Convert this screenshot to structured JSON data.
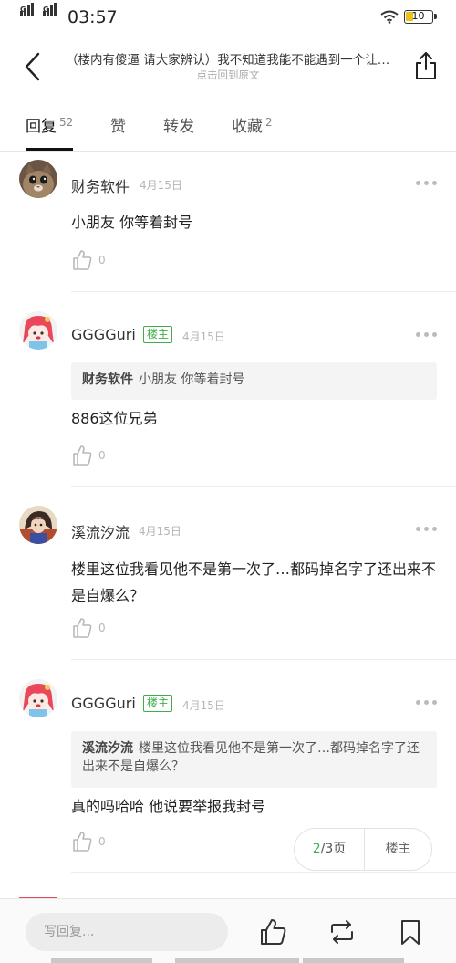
{
  "status_bar": {
    "time": "03:57",
    "sim1_label": "G",
    "sim2_label": "G",
    "battery_level": "10",
    "battery_color": "#e8c31c"
  },
  "header": {
    "thread_title": "（楼内有傻逼 请大家辨认）我不知道我能不能遇到一个让…",
    "back_to_original": "点击回到原文",
    "back_icon": "chevron-left-icon",
    "share_icon": "share-icon"
  },
  "tabs": [
    {
      "label": "回复",
      "count": "52",
      "active": true
    },
    {
      "label": "赞",
      "count": "",
      "active": false
    },
    {
      "label": "转发",
      "count": "",
      "active": false
    },
    {
      "label": "收藏",
      "count": "2",
      "active": false
    }
  ],
  "comments": [
    {
      "username": "财务软件",
      "is_op": false,
      "date": "4月15日",
      "quote": null,
      "text": "小朋友 你等着封号",
      "likes": "0",
      "avatar": "cat-avatar"
    },
    {
      "username": "GGGGuri",
      "is_op": true,
      "op_label": "楼主",
      "date": "4月15日",
      "quote": {
        "user": "财务软件",
        "text": "小朋友 你等着封号"
      },
      "text": "886这位兄弟",
      "likes": "0",
      "avatar": "cartoon-girl-avatar"
    },
    {
      "username": "溪流汐流",
      "is_op": false,
      "date": "4月15日",
      "quote": null,
      "text": "楼里这位我看见他不是第一次了…都码掉名字了还出来不是自爆么？",
      "likes": "0",
      "avatar": "anime-avatar"
    },
    {
      "username": "GGGGuri",
      "is_op": true,
      "op_label": "楼主",
      "date": "4月15日",
      "quote": {
        "user": "溪流汐流",
        "text": "楼里这位我看见他不是第一次了…都码掉名字了还出来不是自爆么？"
      },
      "text": "真的吗哈哈 他说要举报我封号",
      "likes": "0",
      "avatar": "cartoon-girl-avatar"
    }
  ],
  "pager": {
    "current": "2",
    "total_label": "/3页",
    "op_only_label": "楼主"
  },
  "bottom_bar": {
    "reply_placeholder": "写回复...",
    "like_icon": "thumb-up-icon",
    "repost_icon": "repost-icon",
    "favorite_icon": "bookmark-icon"
  },
  "colors": {
    "accent_green": "#3fae49",
    "text_primary": "#222222",
    "text_muted": "#b5b5b5"
  }
}
